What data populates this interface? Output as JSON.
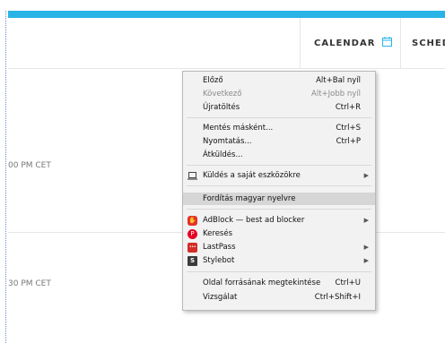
{
  "header": {
    "calendar_label": "CALENDAR",
    "schedule_label": "SCHED"
  },
  "times": [
    "00 PM CET",
    "30 PM CET"
  ],
  "colors": {
    "accent": "#2ab3e6"
  },
  "context_menu": {
    "back": {
      "label": "Előző",
      "shortcut": "Alt+Bal nyíl"
    },
    "forward": {
      "label": "Következő",
      "shortcut": "Alt+Jobb nyíl"
    },
    "reload": {
      "label": "Újratöltés",
      "shortcut": "Ctrl+R"
    },
    "save_as": {
      "label": "Mentés másként...",
      "shortcut": "Ctrl+S"
    },
    "print": {
      "label": "Nyomtatás...",
      "shortcut": "Ctrl+P"
    },
    "cast": {
      "label": "Átküldés..."
    },
    "send_to_devices": {
      "label": "Küldés a saját eszközökre"
    },
    "translate": {
      "label": "Fordítás magyar nyelvre"
    },
    "adblock": {
      "label": "AdBlock — best ad blocker"
    },
    "pinterest": {
      "label": "Keresés"
    },
    "lastpass": {
      "label": "LastPass"
    },
    "stylebot": {
      "label": "Stylebot"
    },
    "view_source": {
      "label": "Oldal forrásának megtekintése",
      "shortcut": "Ctrl+U"
    },
    "inspect": {
      "label": "Vizsgálat",
      "shortcut": "Ctrl+Shift+I"
    }
  }
}
